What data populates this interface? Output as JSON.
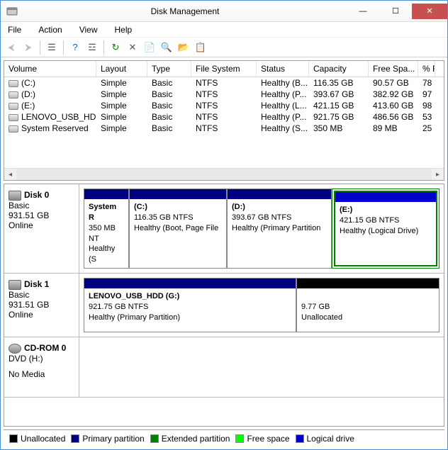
{
  "window": {
    "title": "Disk Management"
  },
  "menu": {
    "file": "File",
    "action": "Action",
    "view": "View",
    "help": "Help"
  },
  "columns": {
    "volume": "Volume",
    "layout": "Layout",
    "type": "Type",
    "fs": "File System",
    "status": "Status",
    "capacity": "Capacity",
    "free": "Free Spa...",
    "pct": "% F"
  },
  "volumes": [
    {
      "name": "(C:)",
      "layout": "Simple",
      "type": "Basic",
      "fs": "NTFS",
      "status": "Healthy (B...",
      "capacity": "116.35 GB",
      "free": "90.57 GB",
      "pct": "78"
    },
    {
      "name": "(D:)",
      "layout": "Simple",
      "type": "Basic",
      "fs": "NTFS",
      "status": "Healthy (P...",
      "capacity": "393.67 GB",
      "free": "382.92 GB",
      "pct": "97"
    },
    {
      "name": "(E:)",
      "layout": "Simple",
      "type": "Basic",
      "fs": "NTFS",
      "status": "Healthy (L...",
      "capacity": "421.15 GB",
      "free": "413.60 GB",
      "pct": "98"
    },
    {
      "name": "LENOVO_USB_HD...",
      "layout": "Simple",
      "type": "Basic",
      "fs": "NTFS",
      "status": "Healthy (P...",
      "capacity": "921.75 GB",
      "free": "486.56 GB",
      "pct": "53"
    },
    {
      "name": "System Reserved",
      "layout": "Simple",
      "type": "Basic",
      "fs": "NTFS",
      "status": "Healthy (S...",
      "capacity": "350 MB",
      "free": "89 MB",
      "pct": "25"
    }
  ],
  "disk0": {
    "name": "Disk 0",
    "type": "Basic",
    "size": "931.51 GB",
    "status": "Online",
    "p0": {
      "title": "System R",
      "l2": "350 MB NT",
      "l3": "Healthy (S"
    },
    "p1": {
      "title": "(C:)",
      "l2": "116.35 GB NTFS",
      "l3": "Healthy (Boot, Page File"
    },
    "p2": {
      "title": "(D:)",
      "l2": "393.67 GB NTFS",
      "l3": "Healthy (Primary Partition"
    },
    "p3": {
      "title": "(E:)",
      "l2": "421.15 GB NTFS",
      "l3": "Healthy (Logical Drive)"
    }
  },
  "disk1": {
    "name": "Disk 1",
    "type": "Basic",
    "size": "931.51 GB",
    "status": "Online",
    "p0": {
      "title": "LENOVO_USB_HDD  (G:)",
      "l2": "921.75 GB NTFS",
      "l3": "Healthy (Primary Partition)"
    },
    "p1": {
      "l2": "9.77 GB",
      "l3": "Unallocated"
    }
  },
  "cdrom": {
    "name": "CD-ROM 0",
    "l2": "DVD (H:)",
    "l3": "No Media"
  },
  "legend": {
    "un": "Unallocated",
    "pr": "Primary partition",
    "ex": "Extended partition",
    "fr": "Free space",
    "lo": "Logical drive"
  }
}
